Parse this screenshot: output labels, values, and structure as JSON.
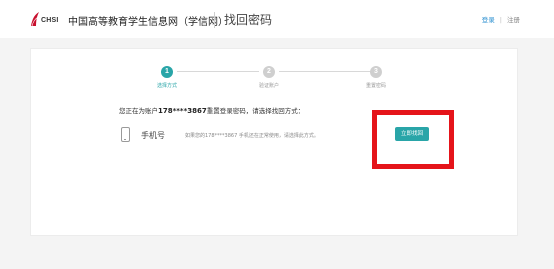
{
  "header": {
    "logo_text": "CHSI",
    "site_name": "中国高等教育学生信息网（学信网）",
    "page_title": "找回密码",
    "login_link": "登录",
    "separator": "|",
    "register_link": "注册"
  },
  "steps": [
    {
      "number": "1",
      "label": "选择方式",
      "state": "active"
    },
    {
      "number": "2",
      "label": "验证账户",
      "state": "inactive"
    },
    {
      "number": "3",
      "label": "重置密码",
      "state": "inactive"
    }
  ],
  "prompt": {
    "prefix": "您正在为账户",
    "account": "178****3867",
    "suffix": "重置登录密码，请选择找回方式："
  },
  "method": {
    "icon": "mobile-phone-icon",
    "label": "手机号",
    "description": "如果您的178****3867 手机还在正常使用，请选择此方式。",
    "button_label": "立即找回"
  },
  "colors": {
    "accent": "#29a5a8",
    "highlight": "#e5141a",
    "brand_red": "#c8102e",
    "link": "#2a8fd0"
  }
}
